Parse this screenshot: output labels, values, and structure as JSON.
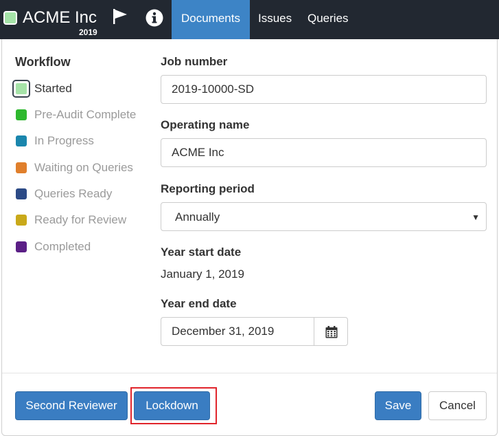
{
  "navbar": {
    "company_name": "ACME Inc",
    "company_year": "2019",
    "badge_color": "#a5e3a8",
    "tabs": [
      {
        "label": "Documents",
        "active": true
      },
      {
        "label": "Issues",
        "active": false
      },
      {
        "label": "Queries",
        "active": false
      }
    ],
    "icons": [
      "flag-icon",
      "info-icon"
    ]
  },
  "workflow": {
    "title": "Workflow",
    "items": [
      {
        "label": "Started",
        "color": "#a5e3a8",
        "current": true
      },
      {
        "label": "Pre-Audit Complete",
        "color": "#2eb82e"
      },
      {
        "label": "In Progress",
        "color": "#1a86ad"
      },
      {
        "label": "Waiting on Queries",
        "color": "#e07f2c"
      },
      {
        "label": "Queries Ready",
        "color": "#2c4a86"
      },
      {
        "label": "Ready for Review",
        "color": "#c9a91a"
      },
      {
        "label": "Completed",
        "color": "#5b1f86"
      }
    ]
  },
  "form": {
    "job_number": {
      "label": "Job number",
      "value": "2019-10000-SD"
    },
    "operating_name": {
      "label": "Operating name",
      "value": "ACME Inc"
    },
    "reporting_period": {
      "label": "Reporting period",
      "value": "Annually"
    },
    "year_start": {
      "label": "Year start date",
      "value": "January 1, 2019"
    },
    "year_end": {
      "label": "Year end date",
      "value": "December 31, 2019",
      "icon": "calendar-icon"
    }
  },
  "footer": {
    "second_reviewer_label": "Second Reviewer",
    "lockdown_label": "Lockdown",
    "save_label": "Save",
    "cancel_label": "Cancel",
    "highlight_color": "#e0242b"
  }
}
